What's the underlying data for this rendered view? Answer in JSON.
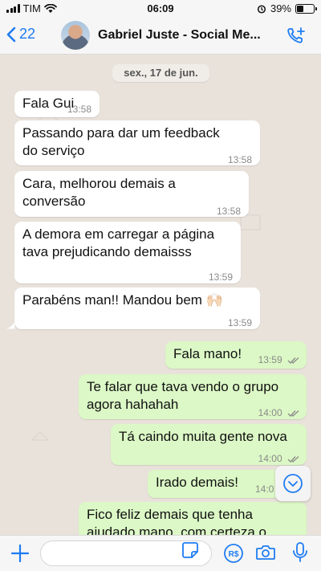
{
  "status": {
    "carrier": "TIM",
    "time": "06:09",
    "battery_percent": "39%",
    "battery_level": 0.39
  },
  "header": {
    "back_count": "22",
    "contact_name": "Gabriel Juste - Social Me..."
  },
  "chat": {
    "date": "sex., 17 de jun.",
    "messages": [
      {
        "dir": "in",
        "lines": [
          "Fala Gui"
        ],
        "time": "13:58"
      },
      {
        "dir": "in",
        "lines": [
          "Passando para dar um feedback",
          "do serviço"
        ],
        "time": "13:58"
      },
      {
        "dir": "in",
        "lines": [
          "Cara, melhorou demais a",
          "conversão"
        ],
        "time": "13:58"
      },
      {
        "dir": "in",
        "lines": [
          "A demora em carregar a página",
          "tava prejudicando demaisss"
        ],
        "time": "13:59"
      },
      {
        "dir": "in",
        "lines": [
          "Parabéns man!! Mandou bem 🙌🏻"
        ],
        "time": "13:59"
      },
      {
        "dir": "out",
        "lines": [
          "Fala mano!"
        ],
        "time": "13:59"
      },
      {
        "dir": "out",
        "lines": [
          "Te falar que tava vendo o grupo",
          "agora hahahah"
        ],
        "time": "14:00"
      },
      {
        "dir": "out",
        "lines": [
          "Tá caindo muita gente nova"
        ],
        "time": "14:00"
      },
      {
        "dir": "out",
        "lines": [
          "Irado demais!"
        ],
        "time": "14:0"
      },
      {
        "dir": "out",
        "lines": [
          "Fico feliz demais que tenha",
          "ajudado mano, com certeza o"
        ],
        "time": ""
      }
    ]
  },
  "colors": {
    "accent": "#1e7cf2",
    "incoming_bubble": "#ffffff",
    "outgoing_bubble": "#dcf8c6",
    "read_checks": "#8a8a8a"
  },
  "icons": {
    "back": "chevron-left-icon",
    "call": "add-call-icon",
    "scroll": "chevron-down-icon",
    "plus": "plus-icon",
    "sticker": "sticker-icon",
    "pay": "pay-icon",
    "camera": "camera-icon",
    "mic": "microphone-icon"
  }
}
